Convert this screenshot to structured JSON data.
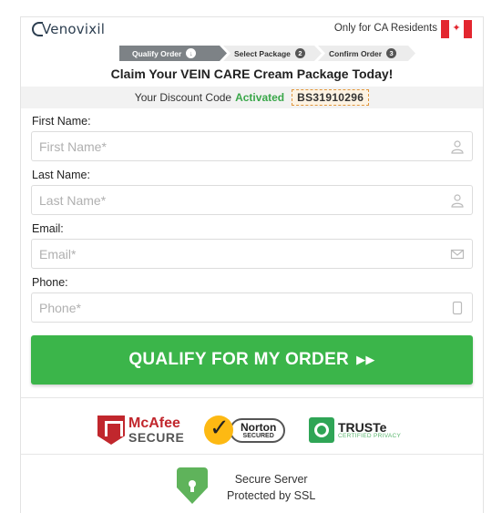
{
  "header": {
    "logo_text": "Venovixil",
    "residents_text": "Only for CA Residents",
    "flag_icon": "canada-flag-icon"
  },
  "steps": [
    {
      "label": "Qualify Order",
      "num": "↓",
      "active": true
    },
    {
      "label": "Select Package",
      "num": "2",
      "active": false
    },
    {
      "label": "Confirm Order",
      "num": "3",
      "active": false
    }
  ],
  "headline": "Claim Your VEIN CARE Cream Package Today!",
  "discount": {
    "prefix": "Your Discount Code",
    "status": "Activated",
    "code": "BS31910296",
    "status_color": "#3aa74a"
  },
  "form": {
    "first_name": {
      "label": "First Name:",
      "placeholder": "First Name*",
      "value": ""
    },
    "last_name": {
      "label": "Last Name:",
      "placeholder": "Last Name*",
      "value": ""
    },
    "email": {
      "label": "Email:",
      "placeholder": "Email*",
      "value": ""
    },
    "phone": {
      "label": "Phone:",
      "placeholder": "Phone*",
      "value": ""
    }
  },
  "cta": {
    "label": "QUALIFY FOR MY ORDER",
    "arrows": "▶▶",
    "color": "#3bb54a"
  },
  "badges": {
    "mcafee_line1": "McAfee",
    "mcafee_line2": "SECURE",
    "norton_line1": "Norton",
    "norton_line2": "SECURED",
    "truste_line1": "TRUSTe",
    "truste_line2": "CERTIFIED PRIVACY"
  },
  "ssl": {
    "line1": "Secure Server",
    "line2": "Protected by SSL"
  }
}
